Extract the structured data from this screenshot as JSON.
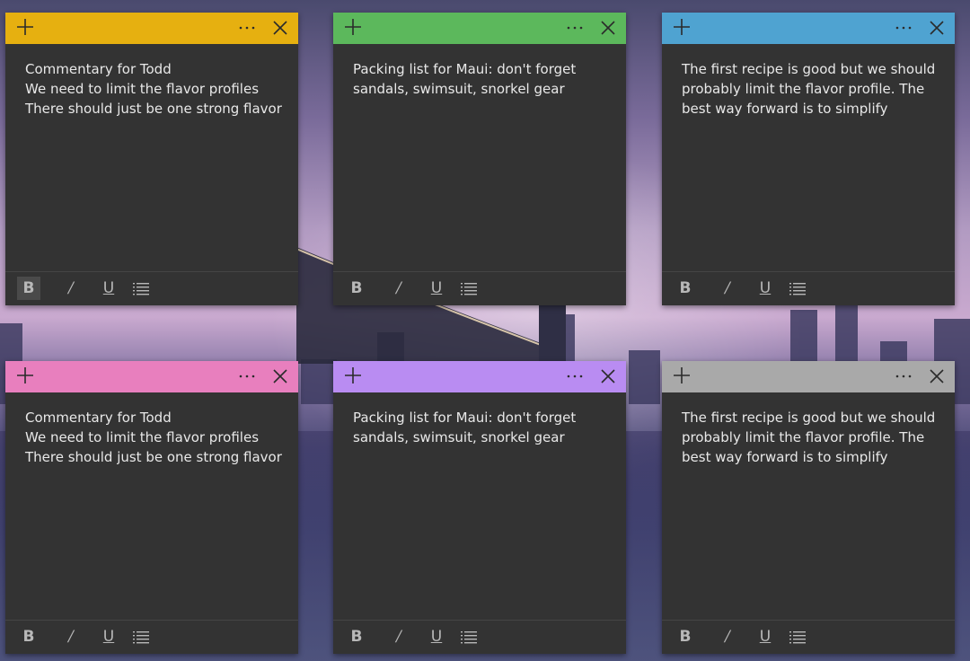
{
  "notes": [
    {
      "color": "#E6B010",
      "lines": [
        "Commentary for Todd",
        "We need to limit the flavor profiles",
        "There should just be one strong flavor"
      ],
      "bold_active": true
    },
    {
      "color": "#5CB85C",
      "lines": [
        "Packing list for Maui: don't forget",
        "sandals, swimsuit, snorkel gear"
      ],
      "bold_active": false
    },
    {
      "color": "#4FA3D1",
      "lines": [
        "The first recipe is good but we should",
        "probably limit the flavor profile. The",
        "best way forward is to simplify"
      ],
      "bold_active": false
    },
    {
      "color": "#E87FBE",
      "lines": [
        "Commentary for Todd",
        "We need to limit the flavor profiles",
        "There should just be one strong flavor"
      ],
      "bold_active": false
    },
    {
      "color": "#B98CF2",
      "lines": [
        "Packing list for Maui: don't forget",
        "sandals, swimsuit, snorkel gear"
      ],
      "bold_active": false
    },
    {
      "color": "#A9A9A9",
      "lines": [
        "The first recipe is good but we should",
        "probably limit the flavor profile. The",
        "best way forward is to simplify"
      ],
      "bold_active": false
    }
  ],
  "toolbar": {
    "bold_label": "B",
    "italic_label": "/",
    "underline_label": "U"
  },
  "icons": {
    "new_note": "plus-icon",
    "menu": "more-dots-icon",
    "close": "close-icon",
    "list": "bullet-list-icon"
  }
}
